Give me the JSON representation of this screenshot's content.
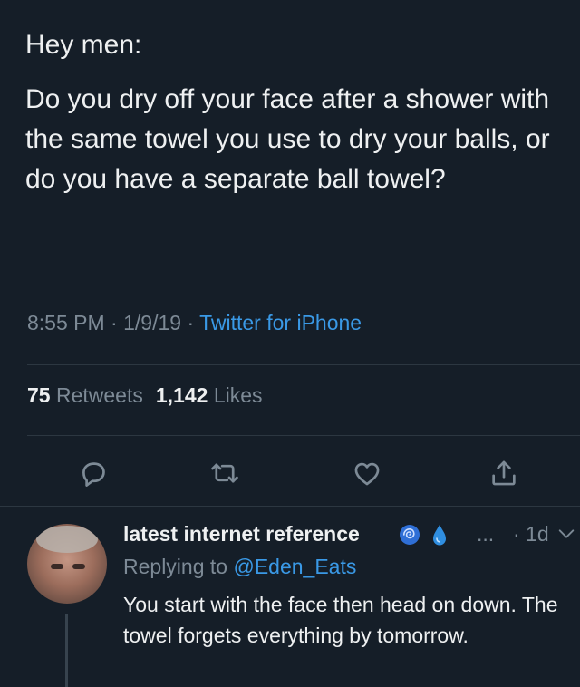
{
  "tweet": {
    "greeting": "Hey men:",
    "body": "Do you dry off your face after a shower with the same towel you use to dry your balls, or do you have a separate ball towel?",
    "time": "8:55 PM",
    "date": "1/9/19",
    "source": "Twitter for iPhone",
    "separator": "·",
    "retweets_count": "75",
    "retweets_label": "Retweets",
    "likes_count": "1,142",
    "likes_label": "Likes"
  },
  "actions": [
    {
      "icon": "reply-icon"
    },
    {
      "icon": "retweet-icon"
    },
    {
      "icon": "like-icon"
    },
    {
      "icon": "share-icon"
    }
  ],
  "reply": {
    "name": "latest internet reference",
    "badges": [
      "spiral-emoji-icon",
      "droplet-emoji-icon"
    ],
    "more": "...",
    "time": "· 1d",
    "replying_prefix": "Replying to",
    "replying_handle": "@Eden_Eats",
    "text": "You start with the face then head on down. The towel forgets everything by tomorrow."
  },
  "colors": {
    "background": "#151e28",
    "text": "#eef0f1",
    "muted": "#7d8a96",
    "link": "#3a99e6",
    "divider": "#2c3741"
  }
}
